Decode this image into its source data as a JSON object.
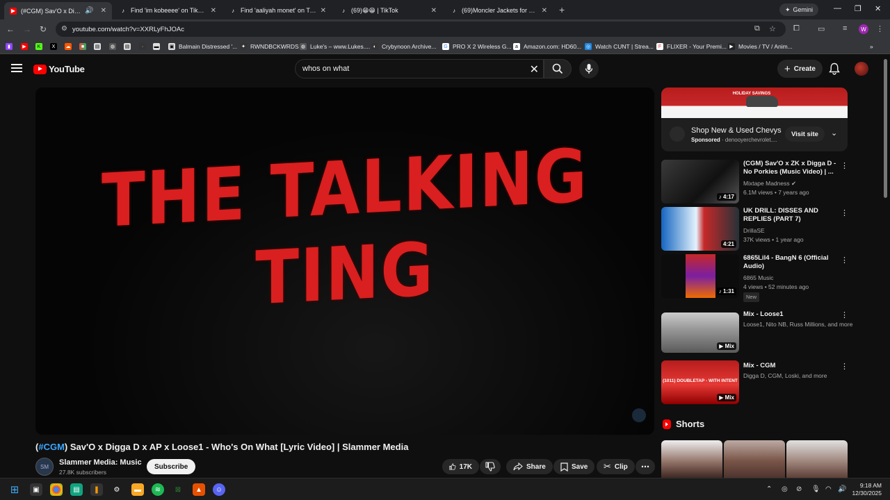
{
  "browser": {
    "tabs": [
      {
        "title": "(#CGM) Sav'O x Digga D x A",
        "active": true
      },
      {
        "title": "Find 'im kobeeee' on TikTok | T"
      },
      {
        "title": "Find 'aaliyah monet' on TikTok"
      },
      {
        "title": "(69)😁😁 | TikTok"
      },
      {
        "title": "(69)Moncler Jackets for Baby a"
      }
    ],
    "gemini_label": "Gemini",
    "url": "youtube.com/watch?v=XXRLyFhJOAc",
    "profile_initial": "W",
    "bookmarks": [
      "Balmain Distressed '...",
      "RWNDBCKWRDS",
      "Luke's – www.Lukes....",
      "Crybynoon Archive...",
      "PRO X 2 Wireless G...",
      "Amazon.com: HD60...",
      "Watch CUNT | Strea...",
      "FLIXER - Your Premi...",
      "Movies / TV / Anim..."
    ]
  },
  "youtube": {
    "logo_text": "YouTube",
    "search_value": "whos on what",
    "create_label": "Create",
    "video": {
      "overlay_text": "THE TALKING TING",
      "title_hash": "#CGM",
      "title_rest": ") Sav'O x Digga D x AP x Loose1 - Who's On What [Lyric Video] | Slammer Media",
      "title_open": "(",
      "channel_name": "Slammer Media: Music",
      "subscribers": "27.8K subscribers",
      "subscribe_label": "Subscribe",
      "likes": "17K",
      "share_label": "Share",
      "save_label": "Save",
      "clip_label": "Clip"
    },
    "ad": {
      "banner_text": "HOLIDAY SAVINGS",
      "title": "Shop New & Used Chevys",
      "sponsored_label": "Sponsored",
      "domain": "denooyerchevrolet....",
      "visit_label": "Visit site"
    },
    "recommendations": [
      {
        "title": "(CGM) Sav'O x ZK x Digga D - No Porkies (Music Video) | ...",
        "channel": "Mixtape Madness",
        "meta": "6.1M views • 7 years ago",
        "duration": "4:17"
      },
      {
        "title": "UK DRILL: DISSES AND REPLIES (PART 7)",
        "channel": "DrillaSE",
        "meta": "37K views • 1 year ago",
        "duration": "4:21"
      },
      {
        "title": "6865Lil4 - BangN 6 (Official Audio)",
        "channel": "6865 Music",
        "meta": "4 views • 52 minutes ago",
        "duration": "1:31",
        "badge": "New"
      },
      {
        "title": "Mix - Loose1",
        "channel": "Loose1, Nito NB, Russ Millions, and more",
        "duration": "Mix"
      },
      {
        "title": "Mix - CGM",
        "channel": "Digga D, CGM, Loski, and more",
        "duration": "Mix",
        "thumb_text": "(1011) DOUBLETAP - WITH INTENT"
      }
    ],
    "shorts_label": "Shorts"
  },
  "taskbar": {
    "time": "9:18 AM",
    "date": "12/30/2025"
  }
}
